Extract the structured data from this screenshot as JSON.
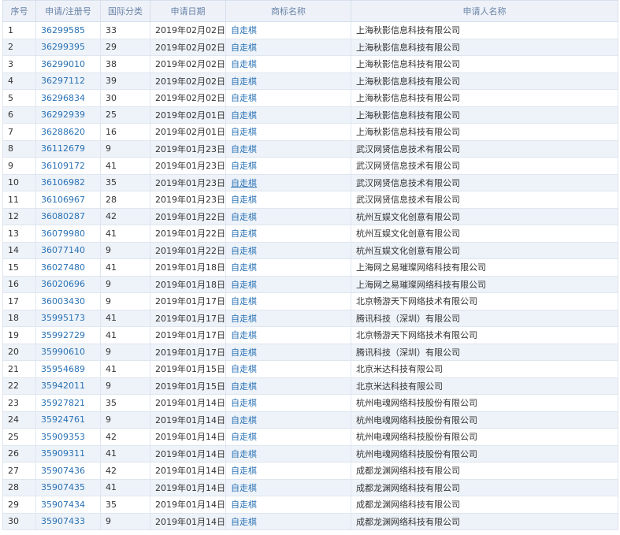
{
  "table": {
    "headers": [
      "序号",
      "申请/注册号",
      "国际分类",
      "申请日期",
      "商标名称",
      "申请人名称"
    ],
    "rows": [
      {
        "no": "1",
        "reg": "36299585",
        "cls": "33",
        "date": "2019年02月02日",
        "name": "自走棋",
        "applicant": "上海秋影信息科技有限公司"
      },
      {
        "no": "2",
        "reg": "36299395",
        "cls": "29",
        "date": "2019年02月02日",
        "name": "自走棋",
        "applicant": "上海秋影信息科技有限公司"
      },
      {
        "no": "3",
        "reg": "36299010",
        "cls": "38",
        "date": "2019年02月02日",
        "name": "自走棋",
        "applicant": "上海秋影信息科技有限公司"
      },
      {
        "no": "4",
        "reg": "36297112",
        "cls": "39",
        "date": "2019年02月02日",
        "name": "自走棋",
        "applicant": "上海秋影信息科技有限公司"
      },
      {
        "no": "5",
        "reg": "36296834",
        "cls": "30",
        "date": "2019年02月02日",
        "name": "自走棋",
        "applicant": "上海秋影信息科技有限公司"
      },
      {
        "no": "6",
        "reg": "36292939",
        "cls": "25",
        "date": "2019年02月01日",
        "name": "自走棋",
        "applicant": "上海秋影信息科技有限公司"
      },
      {
        "no": "7",
        "reg": "36288620",
        "cls": "16",
        "date": "2019年02月01日",
        "name": "自走棋",
        "applicant": "上海秋影信息科技有限公司"
      },
      {
        "no": "8",
        "reg": "36112679",
        "cls": "9",
        "date": "2019年01月23日",
        "name": "自走棋",
        "applicant": "武汉网贤信息技术有限公司"
      },
      {
        "no": "9",
        "reg": "36109172",
        "cls": "41",
        "date": "2019年01月23日",
        "name": "自走棋",
        "applicant": "武汉网贤信息技术有限公司"
      },
      {
        "no": "10",
        "reg": "36106982",
        "cls": "35",
        "date": "2019年01月23日",
        "name": "自走棋",
        "applicant": "武汉网贤信息技术有限公司"
      },
      {
        "no": "11",
        "reg": "36106967",
        "cls": "28",
        "date": "2019年01月23日",
        "name": "自走棋",
        "applicant": "武汉网贤信息技术有限公司"
      },
      {
        "no": "12",
        "reg": "36080287",
        "cls": "42",
        "date": "2019年01月22日",
        "name": "自走棋",
        "applicant": "杭州互娱文化创意有限公司"
      },
      {
        "no": "13",
        "reg": "36079980",
        "cls": "41",
        "date": "2019年01月22日",
        "name": "自走棋",
        "applicant": "杭州互娱文化创意有限公司"
      },
      {
        "no": "14",
        "reg": "36077140",
        "cls": "9",
        "date": "2019年01月22日",
        "name": "自走棋",
        "applicant": "杭州互娱文化创意有限公司"
      },
      {
        "no": "15",
        "reg": "36027480",
        "cls": "41",
        "date": "2019年01月18日",
        "name": "自走棋",
        "applicant": "上海网之易璀璨网络科技有限公司"
      },
      {
        "no": "16",
        "reg": "36020696",
        "cls": "9",
        "date": "2019年01月18日",
        "name": "自走棋",
        "applicant": "上海网之易璀璨网络科技有限公司"
      },
      {
        "no": "17",
        "reg": "36003430",
        "cls": "9",
        "date": "2019年01月17日",
        "name": "自走棋",
        "applicant": "北京畅游天下网络技术有限公司"
      },
      {
        "no": "18",
        "reg": "35995173",
        "cls": "41",
        "date": "2019年01月17日",
        "name": "自走棋",
        "applicant": "腾讯科技（深圳）有限公司"
      },
      {
        "no": "19",
        "reg": "35992729",
        "cls": "41",
        "date": "2019年01月17日",
        "name": "自走棋",
        "applicant": "北京畅游天下网络技术有限公司"
      },
      {
        "no": "20",
        "reg": "35990610",
        "cls": "9",
        "date": "2019年01月17日",
        "name": "自走棋",
        "applicant": "腾讯科技（深圳）有限公司"
      },
      {
        "no": "21",
        "reg": "35954689",
        "cls": "41",
        "date": "2019年01月15日",
        "name": "自走棋",
        "applicant": "北京米达科技有限公司"
      },
      {
        "no": "22",
        "reg": "35942011",
        "cls": "9",
        "date": "2019年01月15日",
        "name": "自走棋",
        "applicant": "北京米达科技有限公司"
      },
      {
        "no": "23",
        "reg": "35927821",
        "cls": "35",
        "date": "2019年01月14日",
        "name": "自走棋",
        "applicant": "杭州电魂网络科技股份有限公司"
      },
      {
        "no": "24",
        "reg": "35924761",
        "cls": "9",
        "date": "2019年01月14日",
        "name": "自走棋",
        "applicant": "杭州电魂网络科技股份有限公司"
      },
      {
        "no": "25",
        "reg": "35909353",
        "cls": "42",
        "date": "2019年01月14日",
        "name": "自走棋",
        "applicant": "杭州电魂网络科技股份有限公司"
      },
      {
        "no": "26",
        "reg": "35909311",
        "cls": "41",
        "date": "2019年01月14日",
        "name": "自走棋",
        "applicant": "杭州电魂网络科技股份有限公司"
      },
      {
        "no": "27",
        "reg": "35907436",
        "cls": "42",
        "date": "2019年01月14日",
        "name": "自走棋",
        "applicant": "成都龙渊网络科技有限公司"
      },
      {
        "no": "28",
        "reg": "35907435",
        "cls": "41",
        "date": "2019年01月14日",
        "name": "自走棋",
        "applicant": "成都龙渊网络科技有限公司"
      },
      {
        "no": "29",
        "reg": "35907434",
        "cls": "35",
        "date": "2019年01月14日",
        "name": "自走棋",
        "applicant": "成都龙渊网络科技有限公司"
      },
      {
        "no": "30",
        "reg": "35907433",
        "cls": "9",
        "date": "2019年01月14日",
        "name": "自走棋",
        "applicant": "成都龙渊网络科技有限公司"
      }
    ]
  },
  "colors": {
    "header_bg": "#eef2f8",
    "header_text": "#6a83a8",
    "link": "#2a72b5",
    "alt_row": "#eef3f9",
    "border": "#dfe6ef"
  }
}
